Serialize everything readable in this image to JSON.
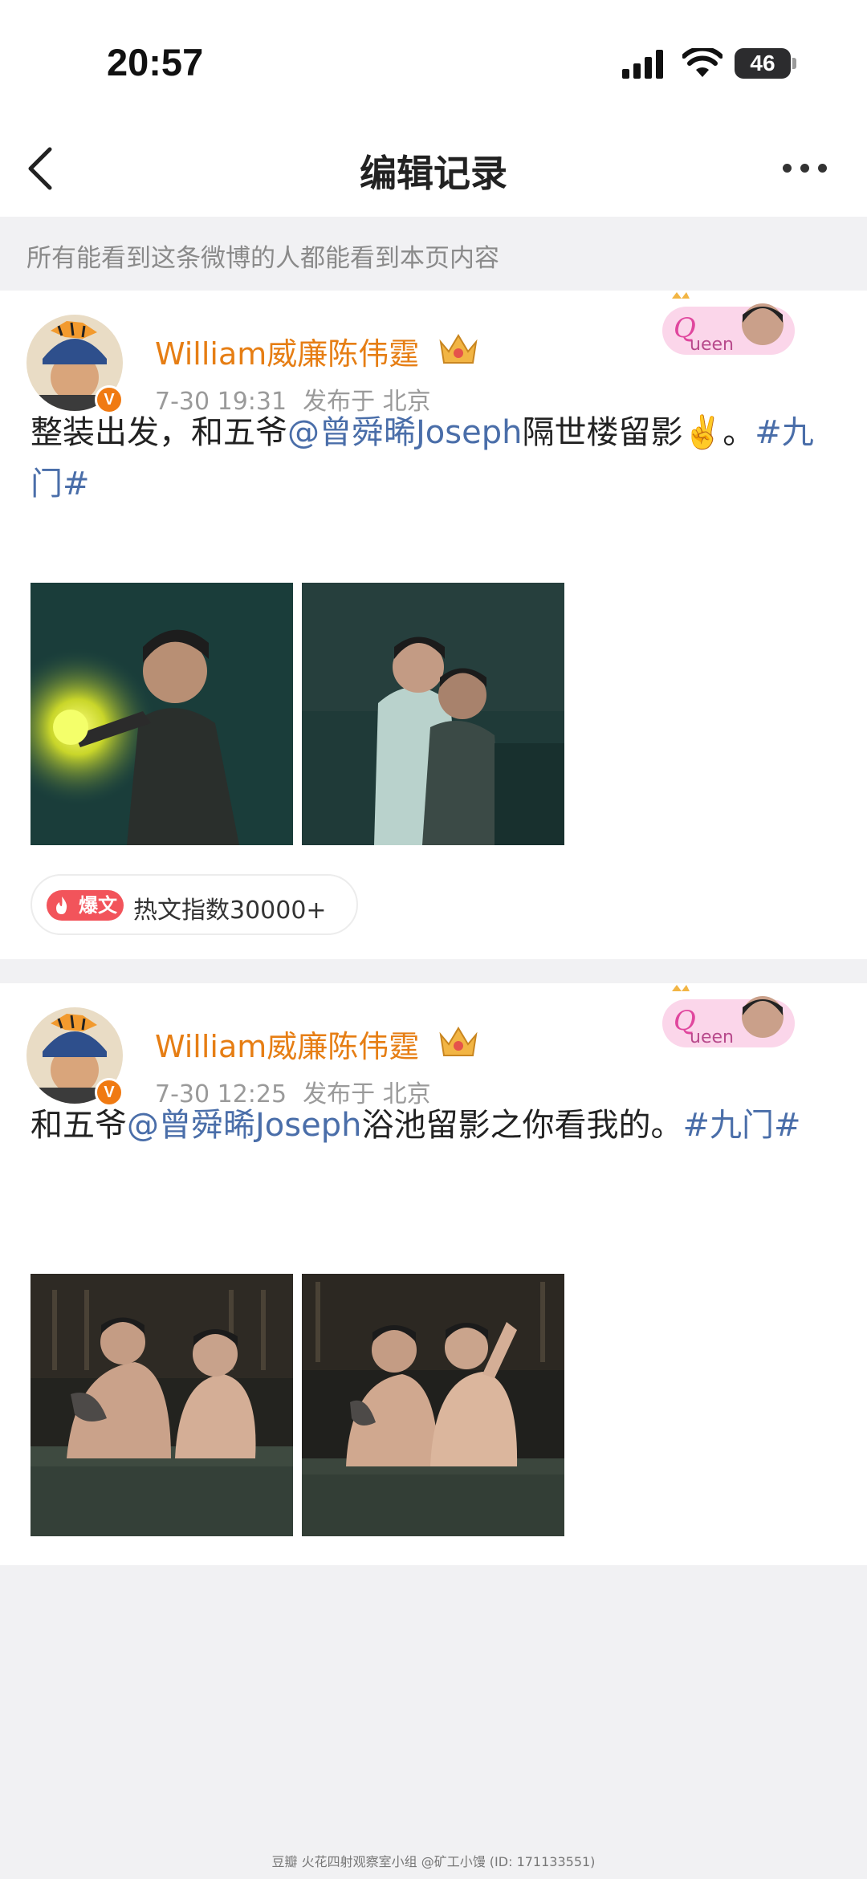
{
  "status_bar": {
    "time": "20:57",
    "battery": "46",
    "icons": [
      "signal-icon",
      "wifi-icon",
      "battery-icon"
    ]
  },
  "nav": {
    "title": "编辑记录",
    "back_icon": "chevron-left-icon",
    "more_icon": "more-dots-icon"
  },
  "notice": "所有能看到这条微博的人都能看到本页内容",
  "posts": [
    {
      "username": "William威廉陈伟霆",
      "date": "7-30 19:31",
      "publish_label": "发布于",
      "location": "北京",
      "text_parts": [
        {
          "text": "整装出发，和五爷",
          "kind": "plain"
        },
        {
          "text": "@曾舜晞Joseph",
          "kind": "mention"
        },
        {
          "text": "隔世楼留影✌️。",
          "kind": "plain"
        },
        {
          "text": "#九门#",
          "kind": "hashtag"
        }
      ],
      "image_count": 2,
      "hot_tag": "爆文",
      "hot_text": "热文指数30000+"
    },
    {
      "username": "William威廉陈伟霆",
      "date": "7-30 12:25",
      "publish_label": "发布于",
      "location": "北京",
      "text_parts": [
        {
          "text": "和五爷",
          "kind": "plain"
        },
        {
          "text": "@曾舜晞Joseph",
          "kind": "mention"
        },
        {
          "text": "浴池留影之你看我的。",
          "kind": "plain"
        },
        {
          "text": "#九门#",
          "kind": "hashtag"
        }
      ],
      "image_count": 2
    }
  ],
  "footer": "豆瓣 火花四射观察室小组 @矿工小馒 (ID: 171133551)",
  "colors": {
    "username": "#e67e14",
    "link": "#4a6ea9",
    "meta": "#9a9a9a",
    "hot_tag": "#f2545b",
    "page_bg": "#f1f1f3"
  }
}
